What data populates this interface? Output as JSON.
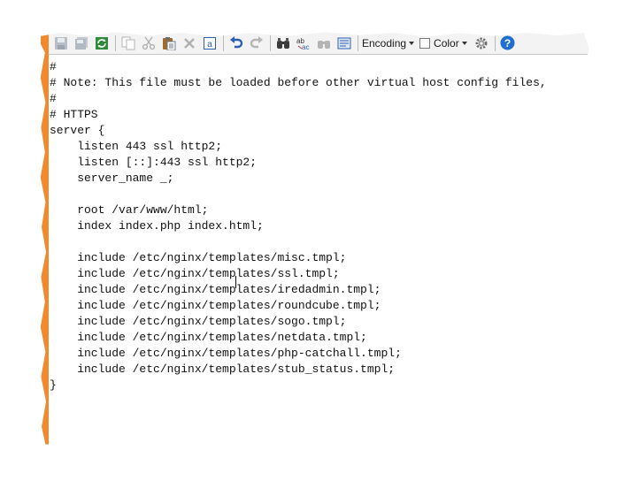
{
  "toolbar": {
    "buttons": [
      {
        "name": "save-icon",
        "enabled": false
      },
      {
        "name": "save-all-icon",
        "enabled": false
      },
      {
        "name": "reload-icon",
        "enabled": true
      },
      {
        "name": "copy-icon",
        "enabled": false
      },
      {
        "name": "cut-icon",
        "enabled": false
      },
      {
        "name": "paste-icon",
        "enabled": true
      },
      {
        "name": "delete-icon",
        "enabled": false
      },
      {
        "name": "select-all-icon",
        "enabled": true
      },
      {
        "name": "undo-icon",
        "enabled": true
      },
      {
        "name": "redo-icon",
        "enabled": false
      },
      {
        "name": "find-icon",
        "enabled": true
      },
      {
        "name": "replace-icon",
        "enabled": true
      },
      {
        "name": "find-next-icon",
        "enabled": false
      },
      {
        "name": "word-wrap-icon",
        "enabled": true
      },
      {
        "name": "settings-icon",
        "enabled": true
      },
      {
        "name": "help-icon",
        "enabled": true
      }
    ],
    "encoding_label": "Encoding",
    "color_label": "Color",
    "color_checked": false,
    "colors": {
      "accent": "#f08a2c",
      "help_blue": "#1e6fd0",
      "icon_blue": "#2b5fb4",
      "icon_green": "#2f8a3a"
    }
  },
  "editor": {
    "lines": [
      "#",
      "# Note: This file must be loaded before other virtual host config files,",
      "#",
      "# HTTPS",
      "server {",
      "    listen 443 ssl http2;",
      "    listen [::]:443 ssl http2;",
      "    server_name _;",
      "",
      "    root /var/www/html;",
      "    index index.php index.html;",
      "",
      "    include /etc/nginx/templates/misc.tmpl;",
      "    include /etc/nginx/templates/ssl.tmpl;",
      "    include /etc/nginx/templates/iredadmin.tmpl;",
      "    include /etc/nginx/templates/roundcube.tmpl;",
      "    include /etc/nginx/templates/sogo.tmpl;",
      "    include /etc/nginx/templates/netdata.tmpl;",
      "    include /etc/nginx/templates/php-catchall.tmpl;",
      "    include /etc/nginx/templates/stub_status.tmpl;",
      "}"
    ]
  }
}
